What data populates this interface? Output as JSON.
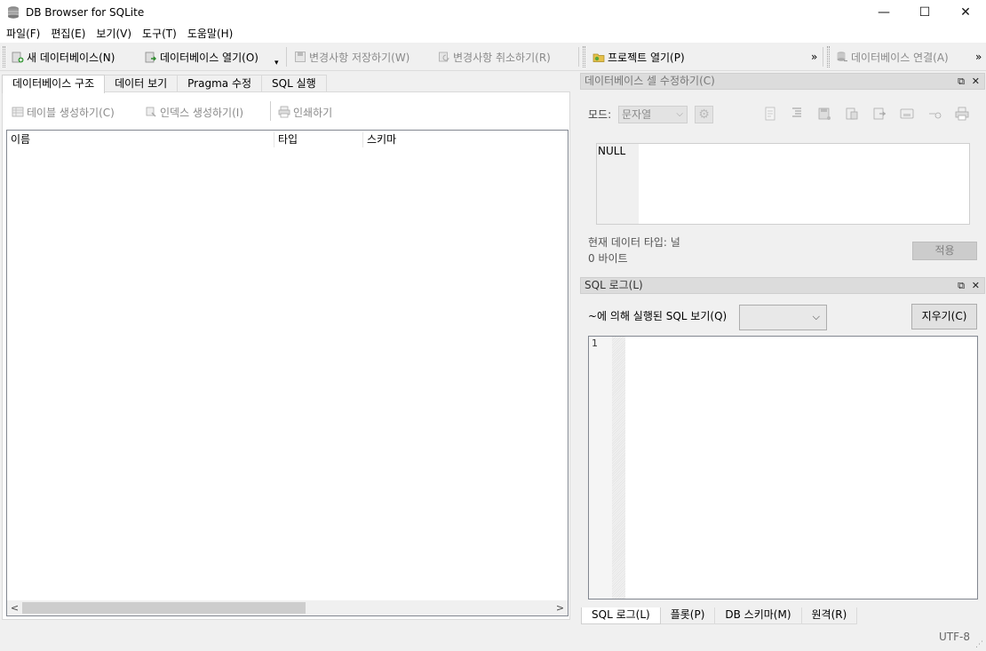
{
  "window": {
    "title": "DB Browser for SQLite",
    "minimize": "—",
    "maximize": "☐",
    "close": "✕"
  },
  "menu": [
    "파일(F)",
    "편집(E)",
    "보기(V)",
    "도구(T)",
    "도움말(H)"
  ],
  "toolbar": {
    "new_db": "새 데이터베이스(N)",
    "open_db": "데이터베이스 열기(O)",
    "open_caret": "▾",
    "write_changes": "변경사항 저장하기(W)",
    "revert_changes": "변경사항 취소하기(R)",
    "open_project": "프로젝트 열기(P)",
    "overflow1": "»",
    "attach_db": "데이터베이스 연결(A)",
    "overflow2": "»"
  },
  "tabs": [
    "데이터베이스 구조",
    "데이터 보기",
    "Pragma 수정",
    "SQL 실행"
  ],
  "structure": {
    "create_table": "테이블 생성하기(C)",
    "create_index": "인덱스 생성하기(I)",
    "print": "인쇄하기",
    "columns": [
      "이름",
      "타입",
      "스키마"
    ],
    "scroll_left": "<",
    "scroll_right": ">"
  },
  "edit_cell": {
    "title": "데이터베이스 셀 수정하기(C)",
    "mode_label": "모드:",
    "mode_value": "문자열",
    "editor_text": "NULL",
    "type_line": "현재 데이터 타입: 널",
    "size_line": "0 바이트",
    "apply": "적용"
  },
  "sql_log": {
    "title": "SQL 로그(L)",
    "show_label": "~에 의해 실행된 SQL 보기(Q)",
    "clear": "지우기(C)",
    "line_number": "1"
  },
  "bottom_tabs": [
    "SQL 로그(L)",
    "플롯(P)",
    "DB 스키마(M)",
    "원격(R)"
  ],
  "status": {
    "encoding": "UTF-8"
  }
}
